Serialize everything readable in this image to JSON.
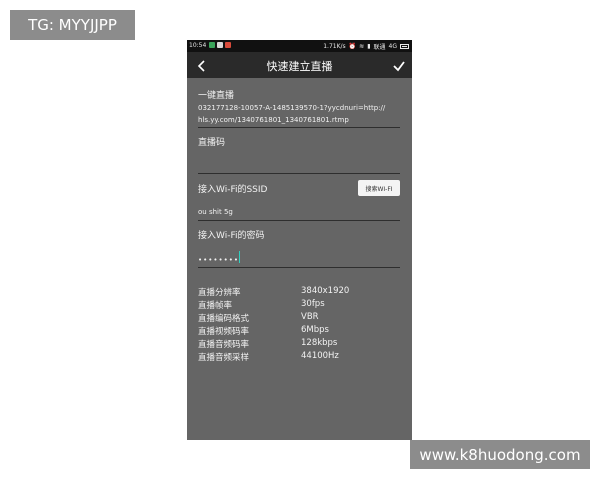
{
  "overlay": {
    "tg_label": "TG: MYYJJPP",
    "watermark": "www.k8huodong.com"
  },
  "statusbar": {
    "time": "10:54",
    "speed": "1.71K/s",
    "carrier": "联通",
    "network": "4G"
  },
  "titlebar": {
    "title": "快速建立直播"
  },
  "form": {
    "one_click_label": "一键直播",
    "stream_url": "032177128-10057-A-1485139570-1?yycdnuri=http://hls.yy.com/1340761801_1340761801.rtmp",
    "stream_url_line1": "032177128-10057-A-1485139570-1?yycdnuri=http://",
    "stream_url_line2": "hls.yy.com/1340761801_1340761801.rtmp",
    "live_code_label": "直播码",
    "live_code_value": "",
    "wifi_ssid_label": "接入Wi-Fi的SSID",
    "search_wifi_button": "搜索WI-FI",
    "wifi_ssid_value": "ou shit 5g",
    "wifi_password_label": "接入Wi-Fi的密码",
    "wifi_password_masked": "••••••••"
  },
  "settings": [
    {
      "key": "直播分辨率",
      "value": "3840x1920"
    },
    {
      "key": "直播帧率",
      "value": "30fps"
    },
    {
      "key": "直播编码格式",
      "value": "VBR"
    },
    {
      "key": "直播视频码率",
      "value": "6Mbps"
    },
    {
      "key": "直播音频码率",
      "value": "128kbps"
    },
    {
      "key": "直播音频采样",
      "value": "44100Hz"
    }
  ],
  "colors": {
    "background": "#656565",
    "titlebar": "#2a2a2a",
    "statusbar": "#111111",
    "cursor": "#2fd0c0"
  },
  "icons": {
    "back": "chevron-left-icon",
    "confirm": "checkmark-icon"
  }
}
